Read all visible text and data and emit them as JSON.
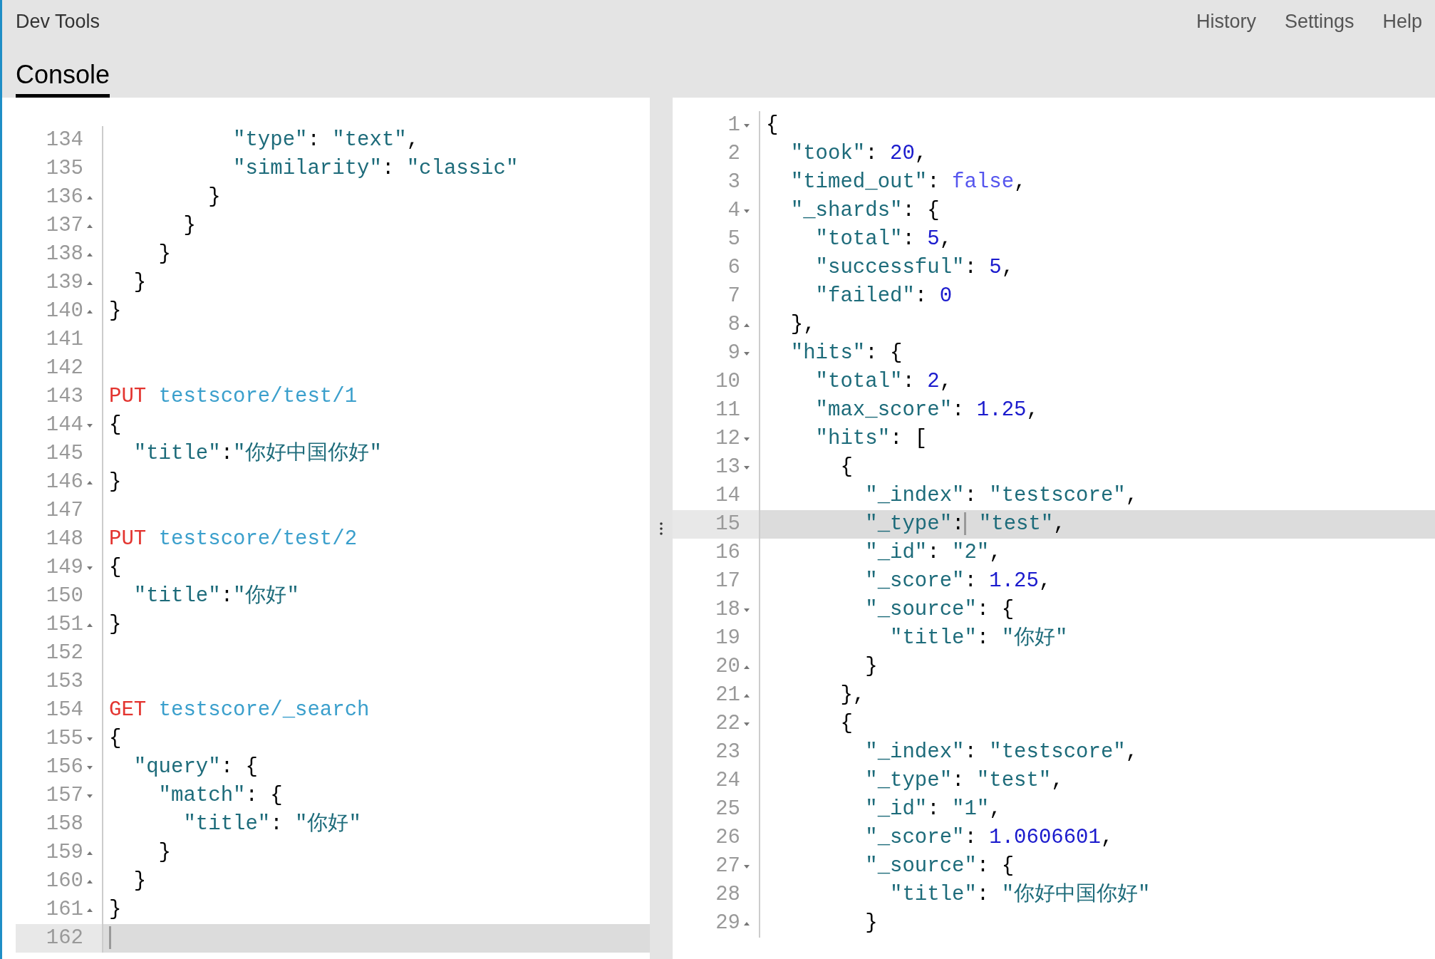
{
  "header": {
    "title": "Dev Tools",
    "nav": [
      "History",
      "Settings",
      "Help"
    ]
  },
  "tabs": [
    {
      "label": "Console",
      "selected": true
    }
  ],
  "request_editor": {
    "lines": [
      {
        "number": "134",
        "kind": "plain",
        "active": false,
        "tokens": [
          {
            "kind": "key",
            "text": "          \"type\""
          },
          {
            "kind": "punct",
            "text": ": "
          },
          {
            "kind": "string",
            "text": "\"text\""
          },
          {
            "kind": "punct",
            "text": ","
          }
        ]
      },
      {
        "number": "135",
        "kind": "plain",
        "active": false,
        "tokens": [
          {
            "kind": "key",
            "text": "          \"similarity\""
          },
          {
            "kind": "punct",
            "text": ": "
          },
          {
            "kind": "string",
            "text": "\"classic\""
          }
        ]
      },
      {
        "number": "136",
        "kind": "closer",
        "active": false,
        "tokens": [
          {
            "kind": "punct",
            "text": "        }"
          }
        ]
      },
      {
        "number": "137",
        "kind": "closer",
        "active": false,
        "tokens": [
          {
            "kind": "punct",
            "text": "      }"
          }
        ]
      },
      {
        "number": "138",
        "kind": "closer",
        "active": false,
        "tokens": [
          {
            "kind": "punct",
            "text": "    }"
          }
        ]
      },
      {
        "number": "139",
        "kind": "closer",
        "active": false,
        "tokens": [
          {
            "kind": "punct",
            "text": "  }"
          }
        ]
      },
      {
        "number": "140",
        "kind": "closer",
        "active": false,
        "tokens": [
          {
            "kind": "punct",
            "text": "}"
          }
        ]
      },
      {
        "number": "141",
        "kind": "plain",
        "active": false
      },
      {
        "number": "142",
        "kind": "plain",
        "active": false
      },
      {
        "number": "143",
        "kind": "plain",
        "active": false,
        "tokens": [
          {
            "kind": "method",
            "text": "PUT "
          },
          {
            "kind": "url",
            "text": "testscore/test/1"
          }
        ]
      },
      {
        "number": "144",
        "kind": "opener",
        "active": false,
        "tokens": [
          {
            "kind": "punct",
            "text": "{"
          }
        ]
      },
      {
        "number": "145",
        "kind": "plain",
        "active": false,
        "tokens": [
          {
            "kind": "key",
            "text": "  \"title\""
          },
          {
            "kind": "punct",
            "text": ":"
          },
          {
            "kind": "string",
            "text": "\"你好中国你好\""
          }
        ]
      },
      {
        "number": "146",
        "kind": "closer",
        "active": false,
        "tokens": [
          {
            "kind": "punct",
            "text": "}"
          }
        ]
      },
      {
        "number": "147",
        "kind": "plain",
        "active": false
      },
      {
        "number": "148",
        "kind": "plain",
        "active": false,
        "tokens": [
          {
            "kind": "method",
            "text": "PUT "
          },
          {
            "kind": "url",
            "text": "testscore/test/2"
          }
        ]
      },
      {
        "number": "149",
        "kind": "opener",
        "active": false,
        "tokens": [
          {
            "kind": "punct",
            "text": "{"
          }
        ]
      },
      {
        "number": "150",
        "kind": "plain",
        "active": false,
        "tokens": [
          {
            "kind": "key",
            "text": "  \"title\""
          },
          {
            "kind": "punct",
            "text": ":"
          },
          {
            "kind": "string",
            "text": "\"你好\""
          }
        ]
      },
      {
        "number": "151",
        "kind": "closer",
        "active": false,
        "tokens": [
          {
            "kind": "punct",
            "text": "}"
          }
        ]
      },
      {
        "number": "152",
        "kind": "plain",
        "active": false
      },
      {
        "number": "153",
        "kind": "plain",
        "active": false
      },
      {
        "number": "154",
        "kind": "plain",
        "active": false,
        "tokens": [
          {
            "kind": "method",
            "text": "GET "
          },
          {
            "kind": "url",
            "text": "testscore/_search"
          }
        ]
      },
      {
        "number": "155",
        "kind": "opener",
        "active": false,
        "tokens": [
          {
            "kind": "punct",
            "text": "{"
          }
        ]
      },
      {
        "number": "156",
        "kind": "opener",
        "active": false,
        "tokens": [
          {
            "kind": "key",
            "text": "  \"query\""
          },
          {
            "kind": "punct",
            "text": ": {"
          }
        ]
      },
      {
        "number": "157",
        "kind": "opener",
        "active": false,
        "tokens": [
          {
            "kind": "key",
            "text": "    \"match\""
          },
          {
            "kind": "punct",
            "text": ": {"
          }
        ]
      },
      {
        "number": "158",
        "kind": "plain",
        "active": false,
        "tokens": [
          {
            "kind": "key",
            "text": "      \"title\""
          },
          {
            "kind": "punct",
            "text": ": "
          },
          {
            "kind": "string",
            "text": "\"你好\""
          }
        ]
      },
      {
        "number": "159",
        "kind": "closer",
        "active": false,
        "tokens": [
          {
            "kind": "punct",
            "text": "    }"
          }
        ]
      },
      {
        "number": "160",
        "kind": "closer",
        "active": false,
        "tokens": [
          {
            "kind": "punct",
            "text": "  }"
          }
        ]
      },
      {
        "number": "161",
        "kind": "closer",
        "active": false,
        "tokens": [
          {
            "kind": "punct",
            "text": "}"
          }
        ]
      },
      {
        "number": "162",
        "kind": "plain",
        "active": true,
        "tokens": [
          {
            "kind": "cursor"
          }
        ]
      }
    ]
  },
  "response_editor": {
    "lines": [
      {
        "number": "1",
        "kind": "opener",
        "active": false,
        "tokens": [
          {
            "kind": "punct",
            "text": "{"
          }
        ]
      },
      {
        "number": "2",
        "kind": "plain",
        "active": false,
        "tokens": [
          {
            "kind": "key",
            "text": "  \"took\""
          },
          {
            "kind": "punct",
            "text": ": "
          },
          {
            "kind": "number",
            "text": "20"
          },
          {
            "kind": "punct",
            "text": ","
          }
        ]
      },
      {
        "number": "3",
        "kind": "plain",
        "active": false,
        "tokens": [
          {
            "kind": "key",
            "text": "  \"timed_out\""
          },
          {
            "kind": "punct",
            "text": ": "
          },
          {
            "kind": "boolean",
            "text": "false"
          },
          {
            "kind": "punct",
            "text": ","
          }
        ]
      },
      {
        "number": "4",
        "kind": "opener",
        "active": false,
        "tokens": [
          {
            "kind": "key",
            "text": "  \"_shards\""
          },
          {
            "kind": "punct",
            "text": ": {"
          }
        ]
      },
      {
        "number": "5",
        "kind": "plain",
        "active": false,
        "tokens": [
          {
            "kind": "key",
            "text": "    \"total\""
          },
          {
            "kind": "punct",
            "text": ": "
          },
          {
            "kind": "number",
            "text": "5"
          },
          {
            "kind": "punct",
            "text": ","
          }
        ]
      },
      {
        "number": "6",
        "kind": "plain",
        "active": false,
        "tokens": [
          {
            "kind": "key",
            "text": "    \"successful\""
          },
          {
            "kind": "punct",
            "text": ": "
          },
          {
            "kind": "number",
            "text": "5"
          },
          {
            "kind": "punct",
            "text": ","
          }
        ]
      },
      {
        "number": "7",
        "kind": "plain",
        "active": false,
        "tokens": [
          {
            "kind": "key",
            "text": "    \"failed\""
          },
          {
            "kind": "punct",
            "text": ": "
          },
          {
            "kind": "number",
            "text": "0"
          }
        ]
      },
      {
        "number": "8",
        "kind": "closer",
        "active": false,
        "tokens": [
          {
            "kind": "punct",
            "text": "  },"
          }
        ]
      },
      {
        "number": "9",
        "kind": "opener",
        "active": false,
        "tokens": [
          {
            "kind": "key",
            "text": "  \"hits\""
          },
          {
            "kind": "punct",
            "text": ": {"
          }
        ]
      },
      {
        "number": "10",
        "kind": "plain",
        "active": false,
        "tokens": [
          {
            "kind": "key",
            "text": "    \"total\""
          },
          {
            "kind": "punct",
            "text": ": "
          },
          {
            "kind": "number",
            "text": "2"
          },
          {
            "kind": "punct",
            "text": ","
          }
        ]
      },
      {
        "number": "11",
        "kind": "plain",
        "active": false,
        "tokens": [
          {
            "kind": "key",
            "text": "    \"max_score\""
          },
          {
            "kind": "punct",
            "text": ": "
          },
          {
            "kind": "number",
            "text": "1.25"
          },
          {
            "kind": "punct",
            "text": ","
          }
        ]
      },
      {
        "number": "12",
        "kind": "opener",
        "active": false,
        "tokens": [
          {
            "kind": "key",
            "text": "    \"hits\""
          },
          {
            "kind": "punct",
            "text": ": ["
          }
        ]
      },
      {
        "number": "13",
        "kind": "opener",
        "active": false,
        "tokens": [
          {
            "kind": "punct",
            "text": "      {"
          }
        ]
      },
      {
        "number": "14",
        "kind": "plain",
        "active": false,
        "tokens": [
          {
            "kind": "key",
            "text": "        \"_index\""
          },
          {
            "kind": "punct",
            "text": ": "
          },
          {
            "kind": "string",
            "text": "\"testscore\""
          },
          {
            "kind": "punct",
            "text": ","
          }
        ]
      },
      {
        "number": "15",
        "kind": "plain",
        "active": true,
        "tokens": [
          {
            "kind": "key",
            "text": "        \"_type\""
          },
          {
            "kind": "punct",
            "text": ":"
          },
          {
            "kind": "cursor"
          },
          {
            "kind": "string",
            "text": " \"test\""
          },
          {
            "kind": "punct",
            "text": ","
          }
        ]
      },
      {
        "number": "16",
        "kind": "plain",
        "active": false,
        "tokens": [
          {
            "kind": "key",
            "text": "        \"_id\""
          },
          {
            "kind": "punct",
            "text": ": "
          },
          {
            "kind": "string",
            "text": "\"2\""
          },
          {
            "kind": "punct",
            "text": ","
          }
        ]
      },
      {
        "number": "17",
        "kind": "plain",
        "active": false,
        "tokens": [
          {
            "kind": "key",
            "text": "        \"_score\""
          },
          {
            "kind": "punct",
            "text": ": "
          },
          {
            "kind": "number",
            "text": "1.25"
          },
          {
            "kind": "punct",
            "text": ","
          }
        ]
      },
      {
        "number": "18",
        "kind": "opener",
        "active": false,
        "tokens": [
          {
            "kind": "key",
            "text": "        \"_source\""
          },
          {
            "kind": "punct",
            "text": ": {"
          }
        ]
      },
      {
        "number": "19",
        "kind": "plain",
        "active": false,
        "tokens": [
          {
            "kind": "key",
            "text": "          \"title\""
          },
          {
            "kind": "punct",
            "text": ": "
          },
          {
            "kind": "string",
            "text": "\"你好\""
          }
        ]
      },
      {
        "number": "20",
        "kind": "closer",
        "active": false,
        "tokens": [
          {
            "kind": "punct",
            "text": "        }"
          }
        ]
      },
      {
        "number": "21",
        "kind": "closer",
        "active": false,
        "tokens": [
          {
            "kind": "punct",
            "text": "      },"
          }
        ]
      },
      {
        "number": "22",
        "kind": "opener",
        "active": false,
        "tokens": [
          {
            "kind": "punct",
            "text": "      {"
          }
        ]
      },
      {
        "number": "23",
        "kind": "plain",
        "active": false,
        "tokens": [
          {
            "kind": "key",
            "text": "        \"_index\""
          },
          {
            "kind": "punct",
            "text": ": "
          },
          {
            "kind": "string",
            "text": "\"testscore\""
          },
          {
            "kind": "punct",
            "text": ","
          }
        ]
      },
      {
        "number": "24",
        "kind": "plain",
        "active": false,
        "tokens": [
          {
            "kind": "key",
            "text": "        \"_type\""
          },
          {
            "kind": "punct",
            "text": ": "
          },
          {
            "kind": "string",
            "text": "\"test\""
          },
          {
            "kind": "punct",
            "text": ","
          }
        ]
      },
      {
        "number": "25",
        "kind": "plain",
        "active": false,
        "tokens": [
          {
            "kind": "key",
            "text": "        \"_id\""
          },
          {
            "kind": "punct",
            "text": ": "
          },
          {
            "kind": "string",
            "text": "\"1\""
          },
          {
            "kind": "punct",
            "text": ","
          }
        ]
      },
      {
        "number": "26",
        "kind": "plain",
        "active": false,
        "tokens": [
          {
            "kind": "key",
            "text": "        \"_score\""
          },
          {
            "kind": "punct",
            "text": ": "
          },
          {
            "kind": "number",
            "text": "1.0606601"
          },
          {
            "kind": "punct",
            "text": ","
          }
        ]
      },
      {
        "number": "27",
        "kind": "opener",
        "active": false,
        "tokens": [
          {
            "kind": "key",
            "text": "        \"_source\""
          },
          {
            "kind": "punct",
            "text": ": {"
          }
        ]
      },
      {
        "number": "28",
        "kind": "plain",
        "active": false,
        "tokens": [
          {
            "kind": "key",
            "text": "          \"title\""
          },
          {
            "kind": "punct",
            "text": ": "
          },
          {
            "kind": "string",
            "text": "\"你好中国你好\""
          }
        ]
      },
      {
        "number": "29",
        "kind": "closer",
        "active": false,
        "tokens": [
          {
            "kind": "punct",
            "text": "        }"
          }
        ]
      }
    ]
  }
}
